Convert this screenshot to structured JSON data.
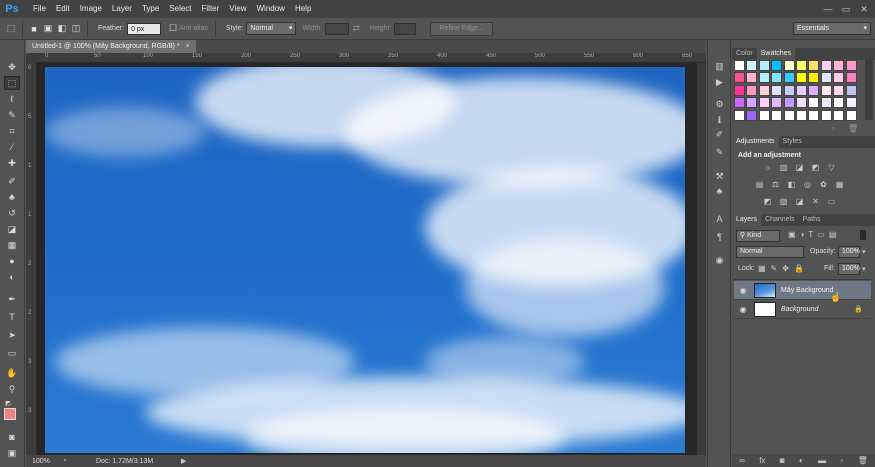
{
  "app": {
    "logo": "Ps"
  },
  "menu": [
    "File",
    "Edit",
    "Image",
    "Layer",
    "Type",
    "Select",
    "Filter",
    "View",
    "Window",
    "Help"
  ],
  "window_controls": [
    "—",
    "▭",
    "✕"
  ],
  "options": {
    "feather_label": "Feather:",
    "feather_value": "0 px",
    "antialias_label": "Anti-alias",
    "style_label": "Style:",
    "style_value": "Normal",
    "width_label": "Width:",
    "height_label": "Height:",
    "refine_edge": "Refine Edge...",
    "workspace": "Essentials"
  },
  "document": {
    "tab_title": "Untitled-1 @ 100% (Mây Background, RGB/8) *",
    "close": "×"
  },
  "ruler": {
    "top_ticks": [
      "0",
      "50",
      "100",
      "150",
      "200",
      "250",
      "300",
      "350",
      "400",
      "450",
      "500",
      "550",
      "600",
      "650"
    ],
    "left_ticks": [
      "0",
      "5",
      "1",
      "1",
      "2",
      "2",
      "3",
      "3"
    ]
  },
  "status": {
    "zoom": "100%",
    "doc": "Doc: 1.72M/3.13M"
  },
  "panels": {
    "color_tabs": [
      "Color",
      "Swatches"
    ],
    "adjustment_tabs": [
      "Adjustments",
      "Styles"
    ],
    "adjustment_title": "Add an adjustment",
    "layer_tabs": [
      "Layers",
      "Channels",
      "Paths"
    ],
    "kind_label": "Kind",
    "blend_mode": "Normal",
    "opacity_label": "Opacity:",
    "opacity_value": "100%",
    "lock_label": "Lock:",
    "fill_label": "Fill:",
    "fill_value": "100%"
  },
  "layers": [
    {
      "name": "Mây Background",
      "selected": true
    },
    {
      "name": "Background",
      "selected": false
    }
  ],
  "swatch_colors": [
    [
      "#ffffff",
      "#ccf2ff",
      "#b3ecff",
      "#00bfff",
      "#ffffcc",
      "#ffff66",
      "#ffe066",
      "#ffccf2",
      "#ffb3d9",
      "#ff99cc"
    ],
    [
      "#ff4d94",
      "#ffb3d1",
      "#b3f0ff",
      "#80e5ff",
      "#33ccff",
      "#ffff00",
      "#ffee00",
      "#e6e6ff",
      "#ffccee",
      "#ff80bf"
    ],
    [
      "#ff3399",
      "#ff99c2",
      "#ffcce0",
      "#e0e0ff",
      "#ccccff",
      "#e6ccff",
      "#d9b3ff",
      "#ffe6f5",
      "#ffd9ec",
      "#c2c2f0"
    ],
    [
      "#cc66ff",
      "#d9a3ff",
      "#ffccff",
      "#e6b3ff",
      "#c299ff",
      "#f0e0ff",
      "#ffffff",
      "#e8e8f8",
      "#ffffff",
      "#f0f0ff"
    ],
    [
      "#ffffff",
      "#9966ff",
      "#ffffff",
      "#ffffff",
      "#ffffff",
      "#ffffff",
      "#ffffff",
      "#ffffff",
      "#ffffff",
      "#ffffff"
    ]
  ]
}
